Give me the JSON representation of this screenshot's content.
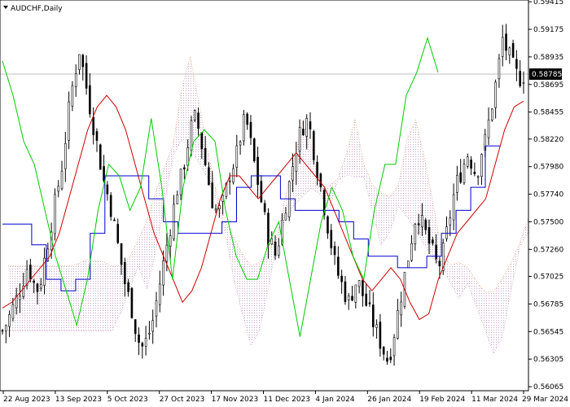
{
  "window": {
    "symbol_label": "AUDCHF,Daily",
    "menu_icon": "triangle-down-icon"
  },
  "colors": {
    "background": "#ffffff",
    "axis": "#000000",
    "candle": "#000000",
    "tenkan": "#cc0000",
    "kijun": "#0000cc",
    "chikou": "#00cc00",
    "kumo_bull": "#c8a0c8",
    "kumo_bear": "#e8a070",
    "price_line": "#c0c0c0",
    "price_label_bg": "#000000",
    "price_label_text": "#ffffff"
  },
  "chart_data": {
    "type": "candlestick",
    "title": "AUDCHF,Daily",
    "ylim": [
      0.5603,
      0.5943
    ],
    "y_ticks": [
      "0.59415",
      "0.59175",
      "0.58935",
      "0.58695",
      "0.58455",
      "0.58220",
      "0.57980",
      "0.57740",
      "0.57500",
      "0.57260",
      "0.57025",
      "0.56785",
      "0.56545",
      "0.56305",
      "0.56065"
    ],
    "x_ticks": [
      "22 Aug 2023",
      "13 Sep 2023",
      "5 Oct 2023",
      "27 Oct 2023",
      "17 Nov 2023",
      "11 Dec 2023",
      "4 Jan 2024",
      "26 Jan 2024",
      "19 Feb 2024",
      "11 Mar 2024",
      "29 Mar 2024"
    ],
    "current_price": "0.58785",
    "close_path": [
      0.5655,
      0.5662,
      0.5671,
      0.568,
      0.569,
      0.5702,
      0.5713,
      0.57,
      0.569,
      0.57,
      0.572,
      0.574,
      0.576,
      0.578,
      0.58,
      0.583,
      0.586,
      0.588,
      0.59,
      0.588,
      0.586,
      0.584,
      0.582,
      0.58,
      0.578,
      0.577,
      0.575,
      0.573,
      0.571,
      0.569,
      0.568,
      0.566,
      0.5645,
      0.564,
      0.565,
      0.566,
      0.568,
      0.57,
      0.572,
      0.574,
      0.576,
      0.578,
      0.579,
      0.581,
      0.583,
      0.584,
      0.583,
      0.581,
      0.579,
      0.577,
      0.576,
      0.576,
      0.577,
      0.579,
      0.58,
      0.581,
      0.583,
      0.584,
      0.582,
      0.58,
      0.578,
      0.576,
      0.574,
      0.573,
      0.572,
      0.574,
      0.576,
      0.578,
      0.58,
      0.582,
      0.583,
      0.584,
      0.583,
      0.581,
      0.579,
      0.577,
      0.575,
      0.573,
      0.571,
      0.57,
      0.569,
      0.568,
      0.569,
      0.57,
      0.569,
      0.568,
      0.567,
      0.566,
      0.565,
      0.564,
      0.563,
      0.564,
      0.566,
      0.568,
      0.57,
      0.572,
      0.574,
      0.576,
      0.575,
      0.574,
      0.573,
      0.572,
      0.571,
      0.572,
      0.574,
      0.576,
      0.578,
      0.579,
      0.58,
      0.581,
      0.58,
      0.579,
      0.581,
      0.582,
      0.584,
      0.586,
      0.588,
      0.591,
      0.59,
      0.589,
      0.588,
      0.5875,
      0.5878
    ],
    "series": [
      {
        "name": "",
        "role": "tenkan",
        "values": [
          0.5675,
          0.568,
          0.569,
          0.57,
          0.571,
          0.572,
          0.574,
          0.577,
          0.58,
          0.583,
          0.585,
          0.586,
          0.585,
          0.583,
          0.58,
          0.577,
          0.574,
          0.572,
          0.57,
          0.568,
          0.569,
          0.571,
          0.574,
          0.577,
          0.579,
          0.579,
          0.578,
          0.577,
          0.578,
          0.579,
          0.58,
          0.581,
          0.58,
          0.579,
          0.578,
          0.576,
          0.574,
          0.572,
          0.57,
          0.569,
          0.57,
          0.571,
          0.57,
          0.568,
          0.5665,
          0.567,
          0.57,
          0.572,
          0.574,
          0.575,
          0.576,
          0.577,
          0.58,
          0.583,
          0.585,
          0.5855
        ]
      },
      {
        "name": "",
        "role": "kijun",
        "values": [
          0.5748,
          0.5748,
          0.573,
          0.57,
          0.569,
          0.57,
          0.574,
          0.579,
          0.579,
          0.579,
          0.577,
          0.575,
          0.574,
          0.574,
          0.574,
          0.575,
          0.578,
          0.579,
          0.579,
          0.577,
          0.576,
          0.576,
          0.576,
          0.575,
          0.5735,
          0.572,
          0.572,
          0.571,
          0.571,
          0.572,
          0.574,
          0.576,
          0.578,
          0.5816,
          0.5816
        ]
      },
      {
        "name": "",
        "role": "chikou",
        "values": [
          0.589,
          0.586,
          0.582,
          0.58,
          0.576,
          0.572,
          0.569,
          0.566,
          0.57,
          0.576,
          0.58,
          0.579,
          0.576,
          0.578,
          0.584,
          0.578,
          0.57,
          0.578,
          0.582,
          0.583,
          0.582,
          0.576,
          0.572,
          0.57,
          0.57,
          0.573,
          0.575,
          0.57,
          0.565,
          0.57,
          0.575,
          0.578,
          0.576,
          0.572,
          0.57,
          0.576,
          0.58,
          0.58,
          0.586,
          0.588,
          0.591,
          0.588
        ]
      }
    ]
  }
}
